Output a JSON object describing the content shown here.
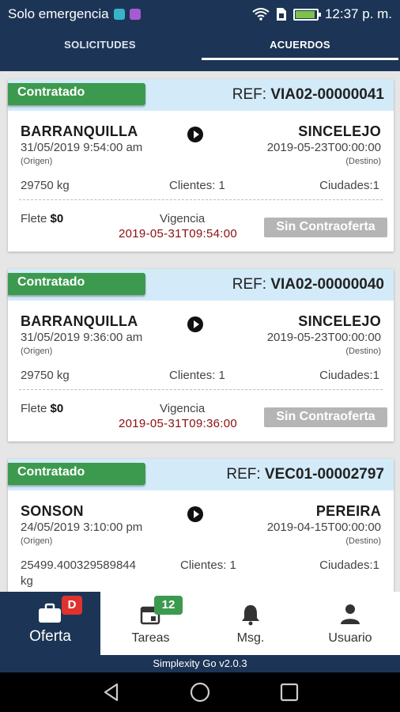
{
  "status_bar": {
    "carrier": "Solo emergencia",
    "time": "12:37 p. m."
  },
  "tabs": [
    {
      "label": "SOLICITUDES",
      "active": false
    },
    {
      "label": "ACUERDOS",
      "active": true
    }
  ],
  "cards": [
    {
      "status": "Contratado",
      "ref_label": "REF:",
      "ref": "VIA02-00000041",
      "origin_city": "BARRANQUILLA",
      "origin_date": "31/05/2019 9:54:00 am",
      "origin_tag": "(Origen)",
      "dest_city": "SINCELEJO",
      "dest_date": "2019-05-23T00:00:00",
      "dest_tag": "(Destino)",
      "weight": "29750 kg",
      "clients": "Clientes: 1",
      "cities": "Ciudades:1",
      "flete_label": "Flete",
      "flete_value": "$0",
      "vigencia_label": "Vigencia",
      "vigencia_date": "2019-05-31T09:54:00",
      "button": "Sin Contraoferta"
    },
    {
      "status": "Contratado",
      "ref_label": "REF:",
      "ref": "VIA02-00000040",
      "origin_city": "BARRANQUILLA",
      "origin_date": "31/05/2019 9:36:00 am",
      "origin_tag": "(Origen)",
      "dest_city": "SINCELEJO",
      "dest_date": "2019-05-23T00:00:00",
      "dest_tag": "(Destino)",
      "weight": "29750 kg",
      "clients": "Clientes: 1",
      "cities": "Ciudades:1",
      "flete_label": "Flete",
      "flete_value": "$0",
      "vigencia_label": "Vigencia",
      "vigencia_date": "2019-05-31T09:36:00",
      "button": "Sin Contraoferta"
    },
    {
      "status": "Contratado",
      "ref_label": "REF:",
      "ref": "VEC01-00002797",
      "origin_city": "SONSON",
      "origin_date": "24/05/2019 3:10:00 pm",
      "origin_tag": "(Origen)",
      "dest_city": "PEREIRA",
      "dest_date": "2019-04-15T00:00:00",
      "dest_tag": "(Destino)",
      "weight_line1": "25499.400329589844",
      "weight_line2": "kg",
      "clients": "Clientes: 1",
      "cities": "Ciudades:1"
    }
  ],
  "bottom_nav": [
    {
      "label": "Oferta",
      "badge": "D",
      "active": true
    },
    {
      "label": "Tareas",
      "badge": "12",
      "active": false
    },
    {
      "label": "Msg.",
      "active": false
    },
    {
      "label": "Usuario",
      "active": false
    }
  ],
  "version": "Simplexity Go v2.0.3",
  "colors": {
    "primary": "#1c3556",
    "badge_green": "#3c9a4e",
    "header_blue": "#d3ebf9",
    "date_red": "#8b0e0e",
    "nav_red": "#e0322f"
  }
}
